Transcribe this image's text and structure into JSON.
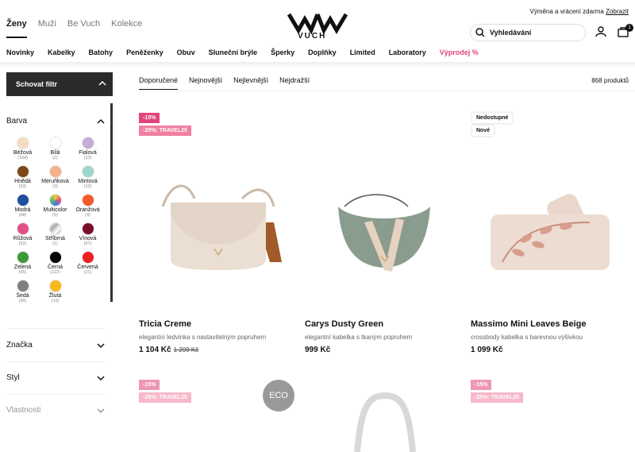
{
  "header": {
    "top_nav": [
      "Ženy",
      "Muži",
      "Be Vuch",
      "Kolekce"
    ],
    "logo_text": "VUCH",
    "return_info": "Výměna a vrácení zdarma",
    "return_link": "Zobrazit",
    "search_placeholder": "Vyhledávání",
    "cart_count": "1",
    "main_nav": [
      "Novinky",
      "Kabelky",
      "Batohy",
      "Peněženky",
      "Obuv",
      "Sluneční brýle",
      "Šperky",
      "Doplňky",
      "Limited",
      "Laboratory",
      "Výprodej %"
    ]
  },
  "filters": {
    "toggle_label": "Schovat filtr",
    "color_title": "Barva",
    "colors": [
      {
        "name": "Béžová",
        "count": "(164)",
        "hex": "#f7dcc4"
      },
      {
        "name": "Bílá",
        "count": "(2)",
        "hex": "#ffffff"
      },
      {
        "name": "Fialová",
        "count": "(10)",
        "hex": "#c4aed8"
      },
      {
        "name": "Hnědá",
        "count": "(93)",
        "hex": "#7b4a14"
      },
      {
        "name": "Meruňková",
        "count": "(3)",
        "hex": "#f5b08e"
      },
      {
        "name": "Mintová",
        "count": "(10)",
        "hex": "#9dd6cc"
      },
      {
        "name": "Modrá",
        "count": "(68)",
        "hex": "#1f4ea0"
      },
      {
        "name": "Multicolor",
        "count": "(5)",
        "hex": "conic"
      },
      {
        "name": "Oranžová",
        "count": "(4)",
        "hex": "#f25a27"
      },
      {
        "name": "Růžová",
        "count": "(52)",
        "hex": "#e24f86"
      },
      {
        "name": "Stříbrná",
        "count": "(1)",
        "hex": "silver"
      },
      {
        "name": "Vínová",
        "count": "(67)",
        "hex": "#7a0e2a"
      },
      {
        "name": "Zelená",
        "count": "(95)",
        "hex": "#3d9a3a"
      },
      {
        "name": "Černá",
        "count": "(222)",
        "hex": "#000000"
      },
      {
        "name": "Červená",
        "count": "(21)",
        "hex": "#ef2020"
      },
      {
        "name": "Šedá",
        "count": "(49)",
        "hex": "#808080"
      },
      {
        "name": "Žlutá",
        "count": "(15)",
        "hex": "#f8b81a"
      }
    ],
    "brand_title": "Značka",
    "style_title": "Styl",
    "props_title": "Vlastnosti"
  },
  "sorting": {
    "options": [
      "Doporučené",
      "Nejnovější",
      "Nejlevnější",
      "Nejdražší"
    ],
    "product_count": "868 produktů"
  },
  "products": [
    {
      "name": "Tricia Creme",
      "desc": "elegantní ledvinka s nastavitelným popruhem",
      "price": "1 104 Kč",
      "old_price": "1 299 Kč",
      "badges": [
        "-15%",
        "-25%: TRAVEL25"
      ]
    },
    {
      "name": "Carys Dusty Green",
      "desc": "elegantní kabelka s tkaným popruhem",
      "price": "999 Kč",
      "old_price": "",
      "badges": []
    },
    {
      "name": "Massimo Mini Leaves Beige",
      "desc": "crossbody kabelka s barevnou výšivkou",
      "price": "1 099 Kč",
      "old_price": "",
      "badges": [
        "Nedostupné",
        "Nové"
      ]
    }
  ],
  "second_row": {
    "badges_left": [
      "-15%",
      "-25%: TRAVEL25"
    ],
    "eco": "ECO",
    "badges_right": [
      "-15%",
      "-25%: TRAVEL25"
    ]
  }
}
